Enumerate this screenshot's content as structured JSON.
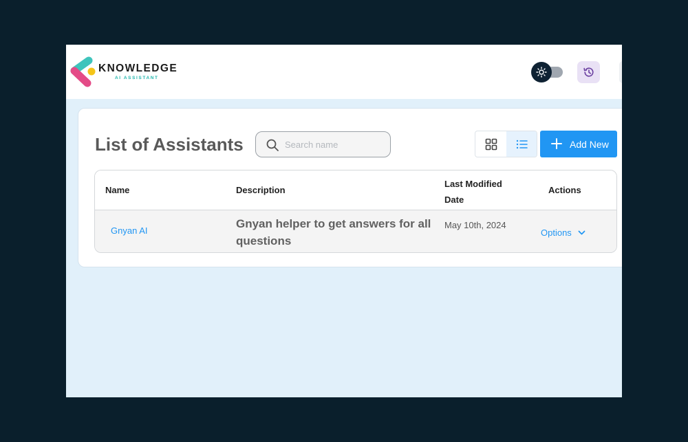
{
  "brand": {
    "name": "KNOWLEDGE",
    "tagline": "AI ASSISTANT",
    "colors": {
      "pink": "#e44b87",
      "teal": "#3fc4bc",
      "yellow": "#f5c518"
    }
  },
  "header": {
    "theme_toggle": {
      "icon": "sun-icon",
      "state": "light"
    },
    "history_button": {
      "icon": "history-icon"
    }
  },
  "page": {
    "title": "List of Assistants",
    "search": {
      "placeholder": "Search name",
      "value": ""
    },
    "view_modes": [
      {
        "name": "grid",
        "icon": "grid-icon",
        "active": false
      },
      {
        "name": "list",
        "icon": "list-icon",
        "active": true
      }
    ],
    "add_button": {
      "label": "Add New",
      "icon": "plus-icon",
      "color": "#2196f3"
    }
  },
  "table": {
    "columns": {
      "name": "Name",
      "description": "Description",
      "last_modified": "Last Modified Date",
      "actions": "Actions"
    },
    "rows": [
      {
        "name": "Gnyan AI",
        "description": "Gnyan helper to get answers for all questions",
        "last_modified": "May 10th, 2024",
        "action_label": "Options"
      }
    ]
  }
}
